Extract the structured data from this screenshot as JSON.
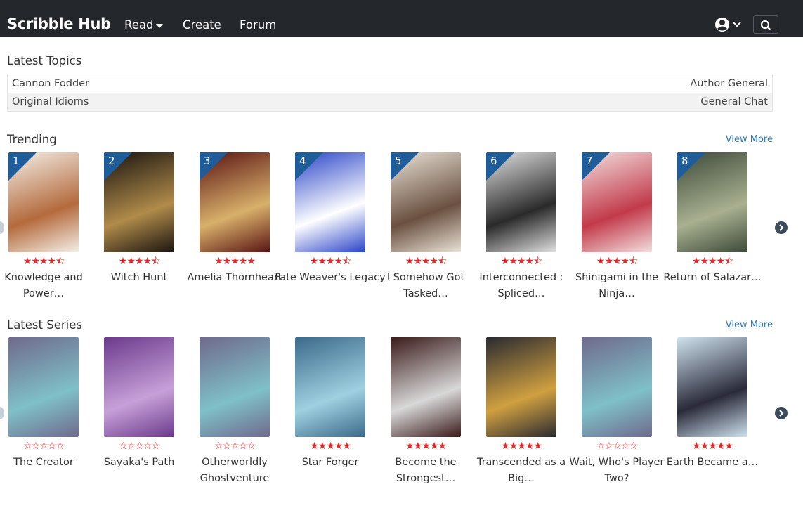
{
  "header": {
    "brand": "Scribble Hub",
    "nav": [
      {
        "label": "Read"
      },
      {
        "label": "Create"
      },
      {
        "label": "Forum"
      }
    ]
  },
  "latest_topics": {
    "heading": "Latest Topics",
    "rows": [
      {
        "title": "Cannon Fodder",
        "forum": "Author General"
      },
      {
        "title": "Original Idioms",
        "forum": "General Chat"
      }
    ]
  },
  "trending": {
    "heading": "Trending",
    "view_more": "View More",
    "items": [
      {
        "rank": "1",
        "title": "Knowledge and Power…",
        "rating": 4.5,
        "cover_colors": [
          "#f4efe8",
          "#b46a3c"
        ]
      },
      {
        "rank": "2",
        "title": "Witch Hunt",
        "rating": 4.5,
        "cover_colors": [
          "#1a1410",
          "#b08b4a"
        ]
      },
      {
        "rank": "3",
        "title": "Amelia Thornheart",
        "rating": 5,
        "cover_colors": [
          "#5a1414",
          "#d8b06a"
        ]
      },
      {
        "rank": "4",
        "title": "Fate Weaver's Legacy",
        "rating": 4.5,
        "cover_colors": [
          "#2a44c8",
          "#ffffff"
        ]
      },
      {
        "rank": "5",
        "title": "I Somehow Got Tasked…",
        "rating": 4.5,
        "cover_colors": [
          "#e8e2d6",
          "#6a5040"
        ]
      },
      {
        "rank": "6",
        "title": "Interconnected : Spliced…",
        "rating": 4.5,
        "cover_colors": [
          "#e0e0e0",
          "#2a2a2a"
        ]
      },
      {
        "rank": "7",
        "title": "Shinigami in the Ninja…",
        "rating": 4.5,
        "cover_colors": [
          "#f2dede",
          "#c23a4a"
        ]
      },
      {
        "rank": "8",
        "title": "Return of Salazar…",
        "rating": 4.5,
        "cover_colors": [
          "#3e4a3a",
          "#a8b090"
        ]
      }
    ]
  },
  "latest_series": {
    "heading": "Latest Series",
    "view_more": "View More",
    "items": [
      {
        "title": "The Creator",
        "rating": 0,
        "cover_colors": [
          "#6f6a8c",
          "#7fc0c8"
        ]
      },
      {
        "title": "Sayaka's Path",
        "rating": 0,
        "cover_colors": [
          "#6b3a8c",
          "#c7a0d8"
        ]
      },
      {
        "title": "Otherworldly Ghostventure",
        "rating": 0,
        "cover_colors": [
          "#6f6a8c",
          "#7fc0c8"
        ]
      },
      {
        "title": "Star Forger",
        "rating": 5,
        "cover_colors": [
          "#3a6a8a",
          "#9fd0e0"
        ]
      },
      {
        "title": "Become the Strongest…",
        "rating": 5,
        "cover_colors": [
          "#3a1a1a",
          "#d8d8d8"
        ]
      },
      {
        "title": "Transcended as a Big…",
        "rating": 5,
        "cover_colors": [
          "#2a2a30",
          "#d0a040"
        ]
      },
      {
        "title": "Wait, Who's Player Two?",
        "rating": 0,
        "cover_colors": [
          "#6f6a8c",
          "#7fc0c8"
        ]
      },
      {
        "title": "Earth Became a…",
        "rating": 5,
        "cover_colors": [
          "#cfe2ee",
          "#2a2a3a"
        ]
      }
    ]
  },
  "colors": {
    "navbar": "#24272b",
    "star": "#e02b2b",
    "link": "#2a7ab7",
    "rank_badge": "#1e5c9a"
  },
  "icons": {
    "user": "user-circle-icon",
    "search": "search-icon",
    "next": "chevron-right-icon"
  }
}
